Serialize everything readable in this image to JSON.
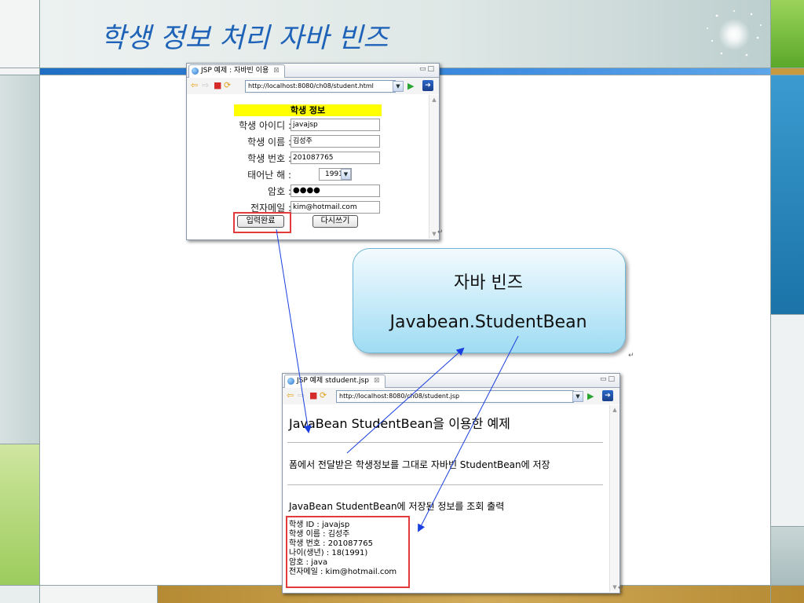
{
  "slide": {
    "title": "학생 정보 처리 자바 빈즈"
  },
  "colors": {
    "title": "#1e63b8",
    "highlight_yellow": "#ffff00",
    "red_box": "#e23b3b",
    "arrow_blue": "#1a3fe0",
    "bean_box": "#9fdcf3",
    "accent_blue_bar": "#1f6fc4",
    "accent_gold_bar": "#c69a3f",
    "accent_green": "#7cc242"
  },
  "form_window": {
    "tab_label": "JSP 예제 : 자바빈 이용",
    "tab_close": "⊠",
    "url": "http://localhost:8080/ch08/student.html",
    "heading": "학생 정보",
    "fields": [
      {
        "label": "학생 아이디 :",
        "value": "javajsp"
      },
      {
        "label": "학생 이름 :",
        "value": "김성주"
      },
      {
        "label": "학생 번호 :",
        "value": "201087765"
      },
      {
        "label": "태어난 해 :",
        "value": "1991"
      },
      {
        "label": "암호 :",
        "value": "●●●●"
      },
      {
        "label": "전자메일 :",
        "value": "kim@hotmail.com"
      }
    ],
    "submit_label": "입력완료",
    "reset_label": "다시쓰기"
  },
  "bean_callout": {
    "title": "자바 빈즈",
    "class_name": "Javabean.StudentBean"
  },
  "result_window": {
    "tab_label": "JSP 예제 stdudent.jsp",
    "tab_close": "⊠",
    "url": "http://localhost:8080/ch08/student.jsp",
    "heading": "JavaBean StudentBean을 이용한 예제",
    "line_store": "폼에서 전달받은 학생정보를 그대로 자바빈 StudentBean에 저장",
    "line_query": "JavaBean StudentBean에 저장된 정보를 조회 출력",
    "output_lines": [
      "학생 ID : javajsp",
      "학생 이름 : 김성주",
      "학생 번호 : 201087765",
      "나이(생년) : 18(1991)",
      "암호 : java",
      "전자메일 : kim@hotmail.com"
    ]
  },
  "para_marks": [
    "↵",
    "↵",
    "↵"
  ],
  "icons": [
    "globe-icon",
    "back-arrow-icon",
    "forward-arrow-icon",
    "stop-icon",
    "refresh-icon",
    "dropdown-icon",
    "go-icon",
    "navigate-icon",
    "minimize-icon",
    "maximize-icon",
    "scroll-up-icon",
    "scroll-down-icon",
    "sparkle-icon"
  ]
}
